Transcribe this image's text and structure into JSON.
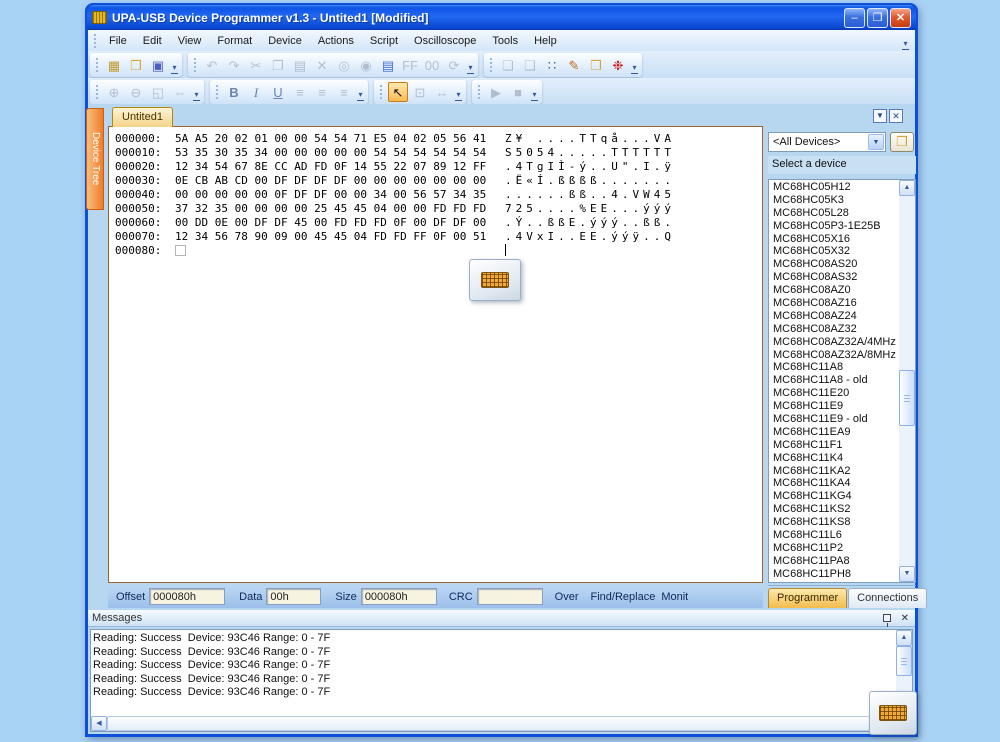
{
  "titlebar": {
    "title": "UPA-USB Device Programmer v1.3 - Untited1 [Modified]"
  },
  "menu": {
    "items": [
      "File",
      "Edit",
      "View",
      "Format",
      "Device",
      "Actions",
      "Script",
      "Oscilloscope",
      "Tools",
      "Help"
    ],
    "overflow_glyph": "»"
  },
  "toolbar1": {
    "g1": [
      {
        "name": "new-file-button",
        "glyph": "▦",
        "state": "on",
        "color": "#c29a2e"
      },
      {
        "name": "open-file-button",
        "glyph": "❒",
        "state": "on",
        "color": "#d9a33c"
      },
      {
        "name": "save-button",
        "glyph": "▣",
        "state": "on",
        "color": "#4a5fc0"
      }
    ],
    "g2": [
      {
        "name": "undo-button",
        "glyph": "↶",
        "state": "dis"
      },
      {
        "name": "redo-button",
        "glyph": "↷",
        "state": "dis"
      },
      {
        "name": "cut-button",
        "glyph": "✂",
        "state": "dis"
      },
      {
        "name": "copy-button",
        "glyph": "❐",
        "state": "dis"
      },
      {
        "name": "paste-button",
        "glyph": "▤",
        "state": "dis"
      },
      {
        "name": "delete-button",
        "glyph": "✕",
        "state": "dis"
      },
      {
        "name": "find-button",
        "glyph": "◎",
        "state": "dis"
      },
      {
        "name": "find-next-button",
        "glyph": "◉",
        "state": "dis"
      },
      {
        "name": "view-document-button",
        "glyph": "▤",
        "state": "on",
        "color": "#3f6fd0"
      },
      {
        "name": "fill-ff-button",
        "glyph": "FF",
        "state": "dis",
        "text": true
      },
      {
        "name": "fill-00-button",
        "glyph": "00",
        "state": "dis",
        "text": true
      },
      {
        "name": "refresh-button",
        "glyph": "⟳",
        "state": "dis"
      }
    ],
    "g3": [
      {
        "name": "prev-page-button",
        "glyph": "❏",
        "state": "dis"
      },
      {
        "name": "next-page-button",
        "glyph": "❏",
        "state": "dis"
      },
      {
        "name": "grid-button",
        "glyph": "∷",
        "state": "on",
        "color": "#35589e"
      },
      {
        "name": "edit-script-button",
        "glyph": "✎",
        "state": "on",
        "color": "#c06a1a"
      },
      {
        "name": "device-folder-button",
        "glyph": "❒",
        "state": "on",
        "color": "#d9a33c"
      },
      {
        "name": "debug-bug-button",
        "glyph": "❉",
        "state": "on",
        "color": "#cc1f1f"
      }
    ]
  },
  "toolbar2": {
    "g1": [
      {
        "name": "zoom-in-button",
        "glyph": "⊕",
        "state": "dis"
      },
      {
        "name": "zoom-out-button",
        "glyph": "⊖",
        "state": "dis"
      },
      {
        "name": "fit-page-button",
        "glyph": "◱",
        "state": "dis"
      },
      {
        "name": "fit-width-button",
        "glyph": "⇔",
        "state": "dis"
      }
    ],
    "g2": [
      {
        "name": "bold-button",
        "glyph": "B",
        "state": "on",
        "kind": "bold",
        "color": "#6c84ad"
      },
      {
        "name": "italic-button",
        "glyph": "I",
        "state": "on",
        "kind": "italic",
        "color": "#6c84ad"
      },
      {
        "name": "underline-button",
        "glyph": "U",
        "state": "on",
        "kind": "underline",
        "color": "#6c84ad"
      },
      {
        "name": "align-left-button",
        "glyph": "≡",
        "state": "dis"
      },
      {
        "name": "align-center-button",
        "glyph": "≡",
        "state": "dis"
      },
      {
        "name": "align-right-button",
        "glyph": "≡",
        "state": "dis"
      }
    ],
    "g3": [
      {
        "name": "select-arrow-button",
        "glyph": "↖",
        "state": "active",
        "color": "#111111"
      },
      {
        "name": "zoom-region-button",
        "glyph": "⊡",
        "state": "dis"
      },
      {
        "name": "measure-width-button",
        "glyph": "↔",
        "state": "dis"
      }
    ],
    "g4": [
      {
        "name": "run-button",
        "glyph": "▶",
        "state": "dis"
      },
      {
        "name": "stop-button",
        "glyph": "■",
        "state": "dis"
      }
    ]
  },
  "doc": {
    "tab_label": "Untited1",
    "device_tree_label": "Device Tree",
    "hex_rows": [
      {
        "offset": "000000:",
        "bytes": "5A A5 20 02 01 00 00 54 54 71 E5 04 02 05 56 41",
        "ascii": "Z¥ ....TTqå...VA"
      },
      {
        "offset": "000010:",
        "bytes": "53 35 30 35 34 00 00 00 00 00 54 54 54 54 54 54",
        "ascii": "S5054.....TTTTTT"
      },
      {
        "offset": "000020:",
        "bytes": "12 34 54 67 8E CC AD FD 0F 14 55 22 07 89 12 FF",
        "ascii": ".4TgIÌ-ý..U\".I.ÿ"
      },
      {
        "offset": "000030:",
        "bytes": "0E CB AB CD 00 DF DF DF DF 00 00 00 00 00 00 00",
        "ascii": ".Ë«Í.ßßßß......."
      },
      {
        "offset": "000040:",
        "bytes": "00 00 00 00 00 0F DF DF 00 00 34 00 56 57 34 35",
        "ascii": "......ßß..4.VW45"
      },
      {
        "offset": "000050:",
        "bytes": "37 32 35 00 00 00 00 25 45 45 04 00 00 FD FD FD",
        "ascii": "725....%EE...ýýý"
      },
      {
        "offset": "000060:",
        "bytes": "00 DD 0E 00 DF DF 45 00 FD FD FD 0F 00 DF DF 00",
        "ascii": ".Ý..ßßE.ýýý..ßß."
      },
      {
        "offset": "000070:",
        "bytes": "12 34 56 78 90 09 00 45 45 04 FD FD FF 0F 00 51",
        "ascii": ".4VxI..EE.ýýÿ..Q"
      }
    ],
    "last_row_offset": "000080:"
  },
  "fields": {
    "offset_label": "Offset",
    "offset_value": "000080h",
    "data_label": "Data",
    "data_value": "00h",
    "size_label": "Size",
    "size_value": "000080h",
    "crc_label": "CRC",
    "crc_value": "",
    "over": "Over",
    "find_replace": "Find/Replace",
    "monit": "Monit"
  },
  "device_panel": {
    "filter_value": "<All Devices>",
    "header": "Select a device",
    "devices": [
      "MC68HC05H12",
      "MC68HC05K3",
      "MC68HC05L28",
      "MC68HC05P3-1E25B",
      "MC68HC05X16",
      "MC68HC05X32",
      "MC68HC08AS20",
      "MC68HC08AS32",
      "MC68HC08AZ0",
      "MC68HC08AZ16",
      "MC68HC08AZ24",
      "MC68HC08AZ32",
      "MC68HC08AZ32A/4MHz",
      "MC68HC08AZ32A/8MHz",
      "MC68HC11A8",
      "MC68HC11A8 - old",
      "MC68HC11E20",
      "MC68HC11E9",
      "MC68HC11E9 - old",
      "MC68HC11EA9",
      "MC68HC11F1",
      "MC68HC11K4",
      "MC68HC11KA2",
      "MC68HC11KA4",
      "MC68HC11KG4",
      "MC68HC11KS2",
      "MC68HC11KS8",
      "MC68HC11L6",
      "MC68HC11P2",
      "MC68HC11PA8",
      "MC68HC11PH8"
    ]
  },
  "side_tabs": {
    "programmer": "Programmer",
    "connections": "Connections"
  },
  "messages": {
    "title": "Messages",
    "lines": [
      "Reading: Success  Device: 93C46 Range: 0 - 7F",
      "Reading: Success  Device: 93C46 Range: 0 - 7F",
      "Reading: Success  Device: 93C46 Range: 0 - 7F",
      "Reading: Success  Device: 93C46 Range: 0 - 7F",
      "Reading: Success  Device: 93C46 Range: 0 - 7F"
    ]
  },
  "glyphs": {
    "minimize": "–",
    "restore": "❐",
    "close": "✕",
    "dropdown": "▼",
    "up": "▲",
    "down": "▼",
    "left": "◀"
  }
}
